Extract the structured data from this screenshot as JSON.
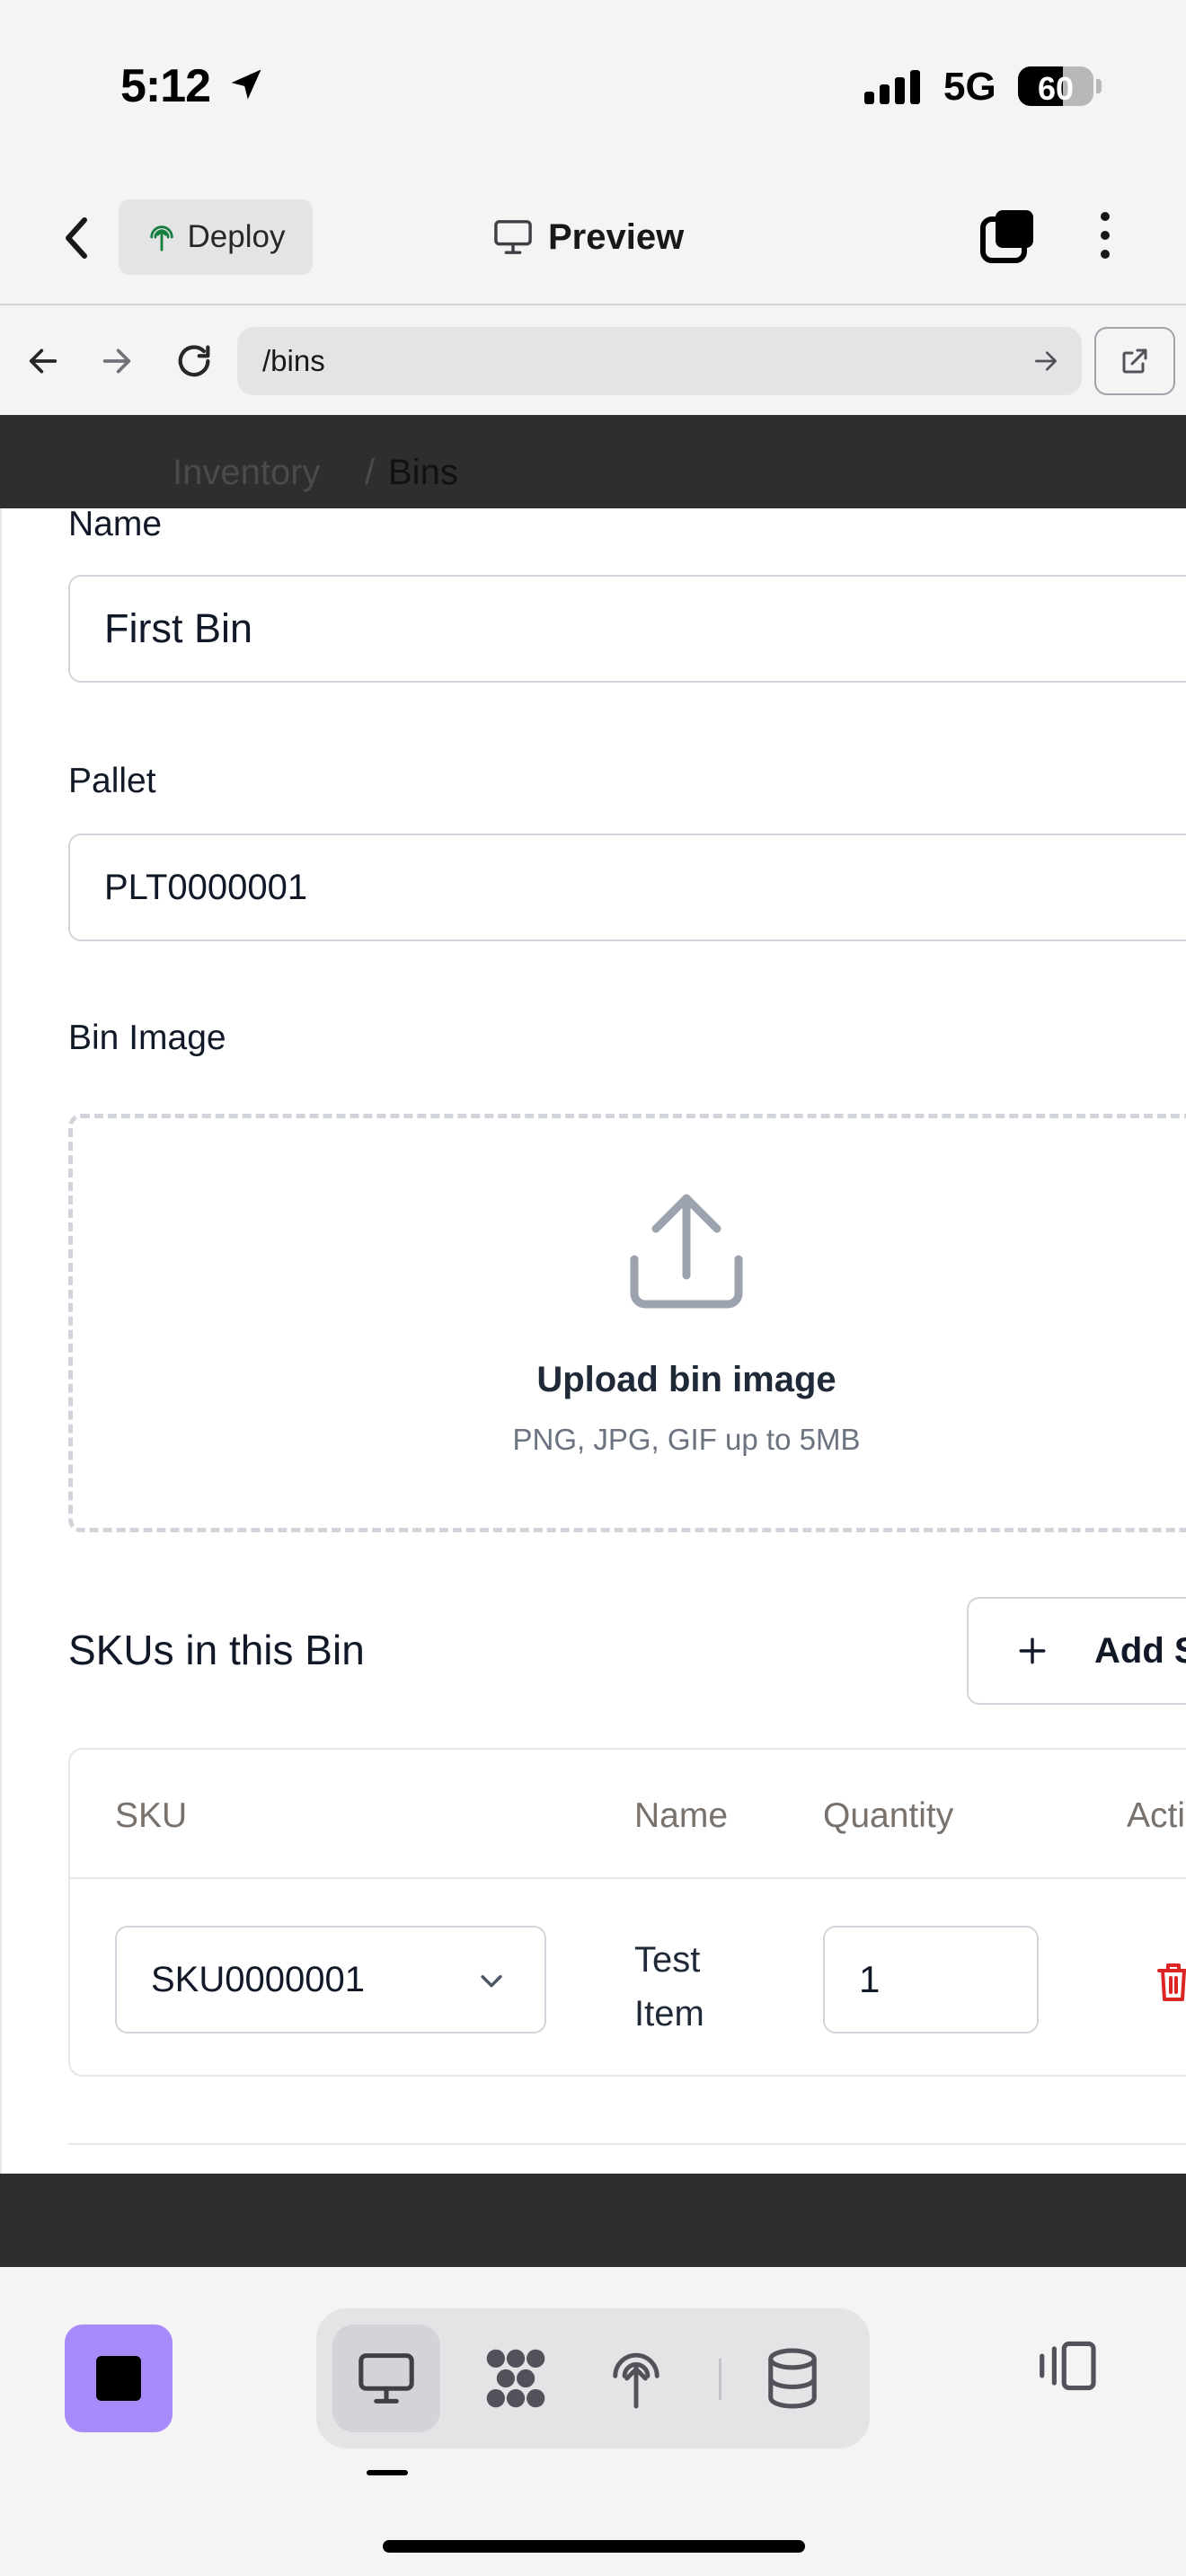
{
  "status_bar": {
    "time": "5:12",
    "network": "5G",
    "battery": "60",
    "battery_level": 0.6
  },
  "header": {
    "deploy_label": "Deploy",
    "preview_label": "Preview"
  },
  "browser": {
    "url": "/bins"
  },
  "breadcrumb": {
    "parent": "Inventory",
    "separator": "/",
    "current": "Bins"
  },
  "form": {
    "name_label": "Name",
    "name_value": "First Bin",
    "pallet_label": "Pallet",
    "pallet_value": "PLT0000001",
    "image_label": "Bin Image",
    "upload_title": "Upload bin image",
    "upload_hint": "PNG, JPG, GIF up to 5MB"
  },
  "skus": {
    "title": "SKUs in this Bin",
    "add_label": "Add SKU",
    "columns": [
      "SKU",
      "Name",
      "Quantity",
      "Actions"
    ],
    "rows": [
      {
        "sku": "SKU0000001",
        "name": "Test Item",
        "quantity": "1"
      }
    ]
  },
  "colors": {
    "accent": "#a78bfa",
    "danger": "#dc2626",
    "viewport_dark": "#2e2e2e"
  },
  "icons": [
    "location-arrow-icon",
    "chevron-left-icon",
    "deploy-icon",
    "monitor-icon",
    "windows-icon",
    "more-vertical-icon",
    "arrow-left-icon",
    "arrow-right-icon",
    "reload-icon",
    "external-link-icon",
    "upload-icon",
    "plus-icon",
    "chevron-down-icon",
    "trash-icon",
    "stop-icon",
    "preview-mode-icon",
    "grid-icon",
    "deploy-mode-icon",
    "database-icon",
    "panel-toggle-icon"
  ]
}
